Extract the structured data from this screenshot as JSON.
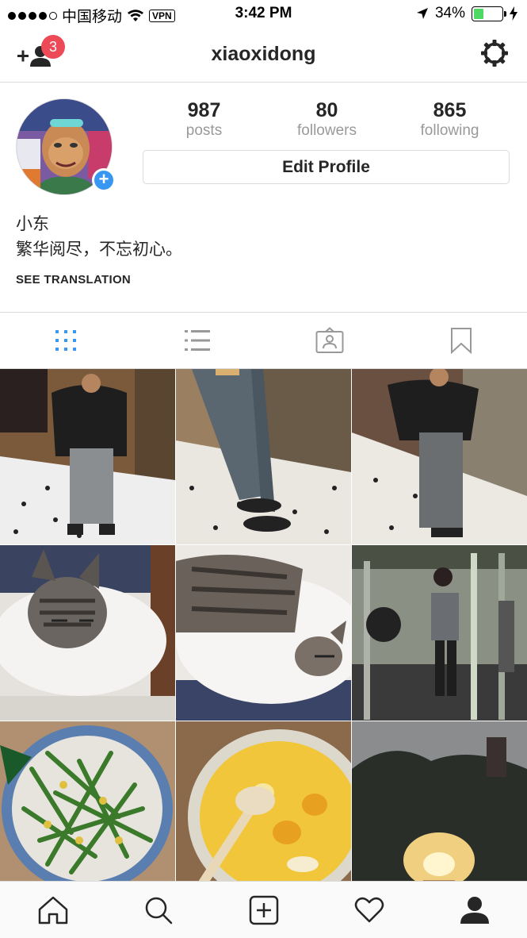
{
  "status_bar": {
    "carrier": "中国移动",
    "vpn": "VPN",
    "time": "3:42 PM",
    "battery": "34%",
    "battery_level": 0.34
  },
  "header": {
    "username": "xiaoxidong",
    "follow_requests_badge": "3"
  },
  "profile": {
    "stats": [
      {
        "value": "987",
        "label": "posts"
      },
      {
        "value": "80",
        "label": "followers"
      },
      {
        "value": "865",
        "label": "following"
      }
    ],
    "edit_profile_label": "Edit Profile",
    "full_name": "小东",
    "bio": "繁华阅尽，不忘初心。",
    "see_translation": "SEE TRANSLATION"
  },
  "view_tabs": [
    "grid",
    "list",
    "tagged",
    "saved"
  ],
  "grid_photos": [
    "mirror-selfie-tiles",
    "legs-on-tiles",
    "mirror-selfie-tiles-2",
    "cat-sleeping-pillow",
    "cat-sleeping-closeup",
    "gym-mirror-selfie",
    "green-beans-plate",
    "soup-bowl",
    "sunset-trees"
  ],
  "tab_bar": [
    "home",
    "search",
    "new-post",
    "activity",
    "profile"
  ],
  "colors": {
    "accent": "#3897f0",
    "badge": "#ed4956",
    "border": "#dbdbdb",
    "text": "#262626",
    "muted": "#999999"
  }
}
